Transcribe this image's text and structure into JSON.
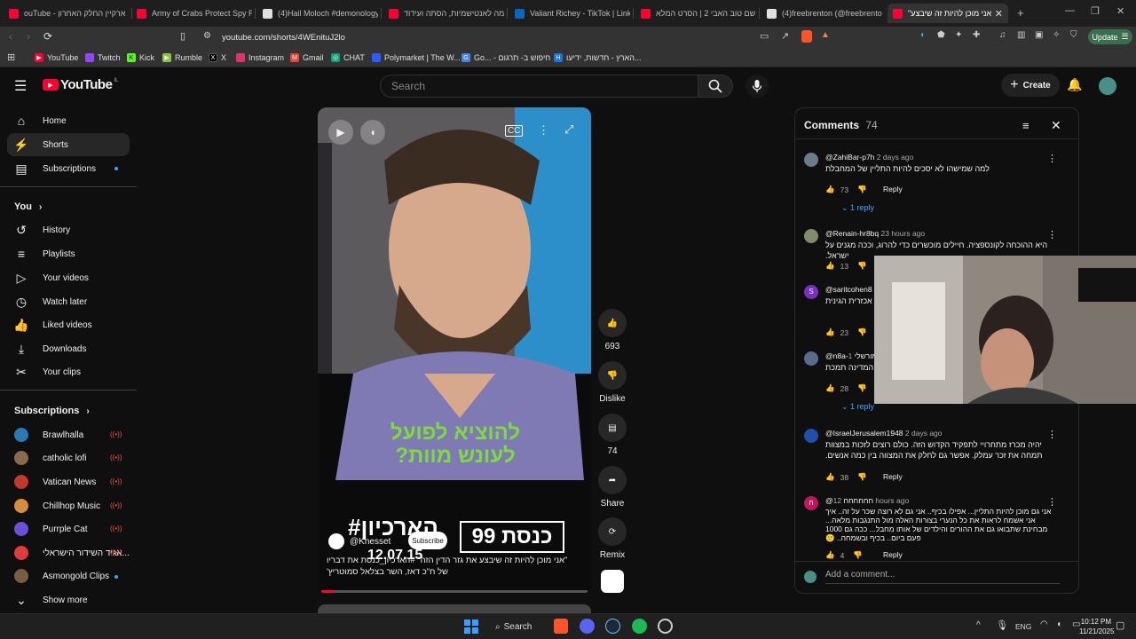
{
  "browser": {
    "tabs": [
      {
        "label": "ouTube - ארקיין החלק האחרון",
        "favicon_color": "#ff0033"
      },
      {
        "label": "Army of Crabs Protect Spy Rob",
        "favicon_color": "#ff0033"
      },
      {
        "label": "(4)Hail Moloch #demonology",
        "favicon_color": "#e0e0e0"
      },
      {
        "label": "במה לאנטישמיות, הסתה ועידוד",
        "favicon_color": "#ff0033"
      },
      {
        "label": "Valiant Richey - TikTok | Linked",
        "favicon_color": "#0a66c2"
      },
      {
        "label": "שם טוב האבי 2 | הסרט המלא",
        "favicon_color": "#ff0033"
      },
      {
        "label": "(4)freebrenton (@freebrenton)",
        "favicon_color": "#e0e0e0"
      },
      {
        "label": "\"אני מוכן להיות זה שיבצע",
        "favicon_color": "#ff0033"
      }
    ],
    "url": "youtube.com/shorts/4WEnituJ2lo",
    "update_label": "Update",
    "bookmarks": [
      {
        "label": "YouTube",
        "color": "#ff0033"
      },
      {
        "label": "Twitch",
        "color": "#9146ff"
      },
      {
        "label": "Kick",
        "color": "#53fc18"
      },
      {
        "label": "Rumble",
        "color": "#85c742"
      },
      {
        "label": "X",
        "color": "#000000"
      },
      {
        "label": "Instagram",
        "color": "#e1306c"
      },
      {
        "label": "Gmail",
        "color": "#ea4335"
      },
      {
        "label": "CHAT",
        "color": "#10a37f"
      },
      {
        "label": "Polymarket | The W...",
        "color": "#2d5bff"
      },
      {
        "label": "Go... - חיפוש ב- תרגום",
        "color": "#4285f4"
      },
      {
        "label": "הארץ - חדשות, ידיעו...",
        "color": "#1a73e8"
      }
    ]
  },
  "youtube": {
    "logo_text": "YouTube",
    "country_code": "IL",
    "search_placeholder": "Search",
    "create_label": "Create",
    "nav": [
      {
        "label": "Home",
        "icon": "home-icon"
      },
      {
        "label": "Shorts",
        "icon": "shorts-icon"
      },
      {
        "label": "Subscriptions",
        "icon": "subscriptions-icon"
      }
    ],
    "you_heading": "You",
    "you_items": [
      {
        "label": "History",
        "icon": "history-icon"
      },
      {
        "label": "Playlists",
        "icon": "playlists-icon"
      },
      {
        "label": "Your videos",
        "icon": "your-videos-icon"
      },
      {
        "label": "Watch later",
        "icon": "watch-later-icon"
      },
      {
        "label": "Liked videos",
        "icon": "liked-icon"
      },
      {
        "label": "Downloads",
        "icon": "download-icon"
      },
      {
        "label": "Your clips",
        "icon": "clips-icon"
      }
    ],
    "subscriptions_heading": "Subscriptions",
    "subscriptions": [
      {
        "label": "Brawlhalla",
        "color": "#2a7ab8",
        "live": true
      },
      {
        "label": "catholic lofi",
        "color": "#8a6a4a",
        "live": true
      },
      {
        "label": "Vatican News",
        "color": "#c0392b",
        "live": true
      },
      {
        "label": "Chillhop Music",
        "color": "#d98c3f",
        "live": true
      },
      {
        "label": "Purrple Cat",
        "color": "#6b4fd6",
        "live": true
      },
      {
        "label": "אגיד השידור הישראלי...",
        "color": "#e23b3b",
        "live": true
      },
      {
        "label": "Asmongold Clips",
        "color": "#7a5c40",
        "live": false
      }
    ],
    "show_more_label": "Show more"
  },
  "short": {
    "overlay_headline_line1": "להוציא לפועל",
    "overlay_headline_line2": "לעונש מוות?",
    "channel_logo_text": "כנסת 99",
    "program_text": "#הארכיון",
    "program_date": "12.07.15",
    "channel_handle": "@Knesset",
    "subscribe_label": "Subscribe",
    "caption": "\"אני מוכן להיות זה שיבצע את גזר הדין הזה\" #הארכיון_כנסת את דבריו של ח\"כ דאז, השר בצלאל סמוטריץ'",
    "progress": 0.05,
    "actions": {
      "likes": "693",
      "dislike_label": "Dislike",
      "comments": "74",
      "share_label": "Share",
      "remix_label": "Remix"
    }
  },
  "comments_panel": {
    "title": "Comments",
    "count": "74",
    "add_placeholder": "Add a comment...",
    "items": [
      {
        "author": "@ZahiBar-p7h",
        "time": "2 days ago",
        "text": "למה שמישהו לא יסכים להיות התליין של המחבלת",
        "likes": "73",
        "reply_label": "Reply",
        "replies": "1 reply",
        "color": "#6c7a89"
      },
      {
        "author": "@Renain-hr8bq",
        "time": "23 hours ago",
        "text": "היא ההוכחה לקונספציה. חיילים מוכשרים כדי להרוג, וככה מגנים על ישראל.",
        "likes": "13",
        "reply_label": "Reply",
        "replies": "",
        "color": "#7f8c6a"
      },
      {
        "author": "@saritcohen8",
        "time": "",
        "text": "רחום על אכזרים ... תהיה אכזרית הגינית",
        "likes": "23",
        "reply_label": "Reply",
        "replies": "",
        "color": "#7b2fbf"
      },
      {
        "author": "@n8a-מורשלי",
        "time": "1",
        "text": "המדינה תמכת",
        "likes": "28",
        "reply_label": "Reply",
        "replies": "1 reply",
        "color": "#5a6b8c"
      },
      {
        "author": "@IsraelJerusalem1948",
        "time": "2 days ago",
        "text": "יהיה מכרז מתחרויי לתפקיד הקדוש הזה. כולם רוצים לזכות במצוות תמחה את זכר עמלק. אפשר גם לחלק את המצווה בין כמה אנשים.",
        "likes": "38",
        "reply_label": "Reply",
        "replies": "",
        "color": "#1f4fa8"
      },
      {
        "author": "@חחחחחח",
        "time": "12 hours ago",
        "text": "אני גם מוכן להיות התליין... אפילו בכיף.. אני גם לא רוצה שכר על זה.. איך אני אשמח לראות את כל הנערי בצורות האלה מול התנגבות מלאה... מבחינת שתבואו גם את ההורים והילדים של אותו מחבל... ככה גם 1000 פעם ביום.. בכיף ובשמחה.. 🙂",
        "likes": "4",
        "reply_label": "Reply",
        "replies": "",
        "color": "#c2185b"
      }
    ]
  },
  "taskbar": {
    "search_label": "Search",
    "lang": "ENG",
    "time": "10:12 PM",
    "date": "11/21/2025"
  }
}
